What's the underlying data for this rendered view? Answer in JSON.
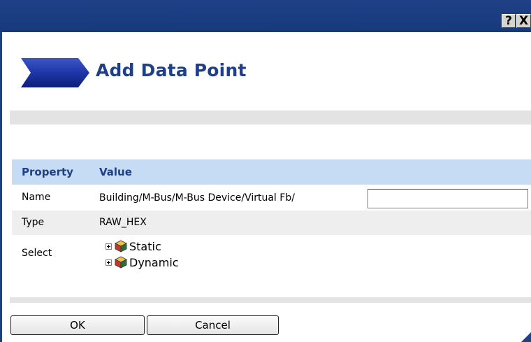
{
  "window": {
    "help_label": "?",
    "close_label": "X"
  },
  "dialog": {
    "title": "Add Data Point"
  },
  "table": {
    "headers": {
      "property": "Property",
      "value": "Value"
    },
    "rows": {
      "name": {
        "label": "Name",
        "path": "Building/M-Bus/M-Bus Device/Virtual Fb/",
        "input_value": ""
      },
      "type": {
        "label": "Type",
        "value": "RAW_HEX"
      },
      "select": {
        "label": "Select",
        "tree": [
          {
            "label": "Static",
            "icon": "cube-icon"
          },
          {
            "label": "Dynamic",
            "icon": "cube-icon"
          }
        ]
      }
    }
  },
  "buttons": {
    "ok": "OK",
    "cancel": "Cancel"
  },
  "colors": {
    "titlebar": "#1f3f86",
    "header_bg": "#c6dcf4",
    "title_text": "#1f3f86"
  }
}
